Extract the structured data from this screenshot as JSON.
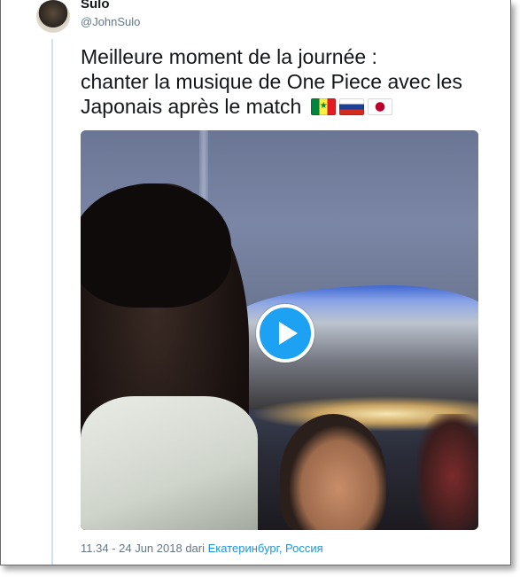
{
  "tweet": {
    "author": {
      "display_name": "Sulo",
      "handle": "@JohnSulo"
    },
    "text_lines": [
      "Meilleure moment de la journée :",
      "chanter la musique de One Piece avec les",
      "Japonais après le match"
    ],
    "flags": [
      "senegal-flag-icon",
      "russia-flag-icon",
      "japan-flag-icon"
    ],
    "media": {
      "type": "video",
      "play_icon": "play-icon"
    },
    "meta": {
      "time_date": "11.34 - 24 Jun 2018",
      "from_word": "dari",
      "location": "Екатеринбург, Россия"
    }
  },
  "colors": {
    "accent": "#1da1f2",
    "link": "#1b95e0",
    "muted": "#657786",
    "text": "#14171a",
    "thread_line": "#cfe0ee"
  }
}
